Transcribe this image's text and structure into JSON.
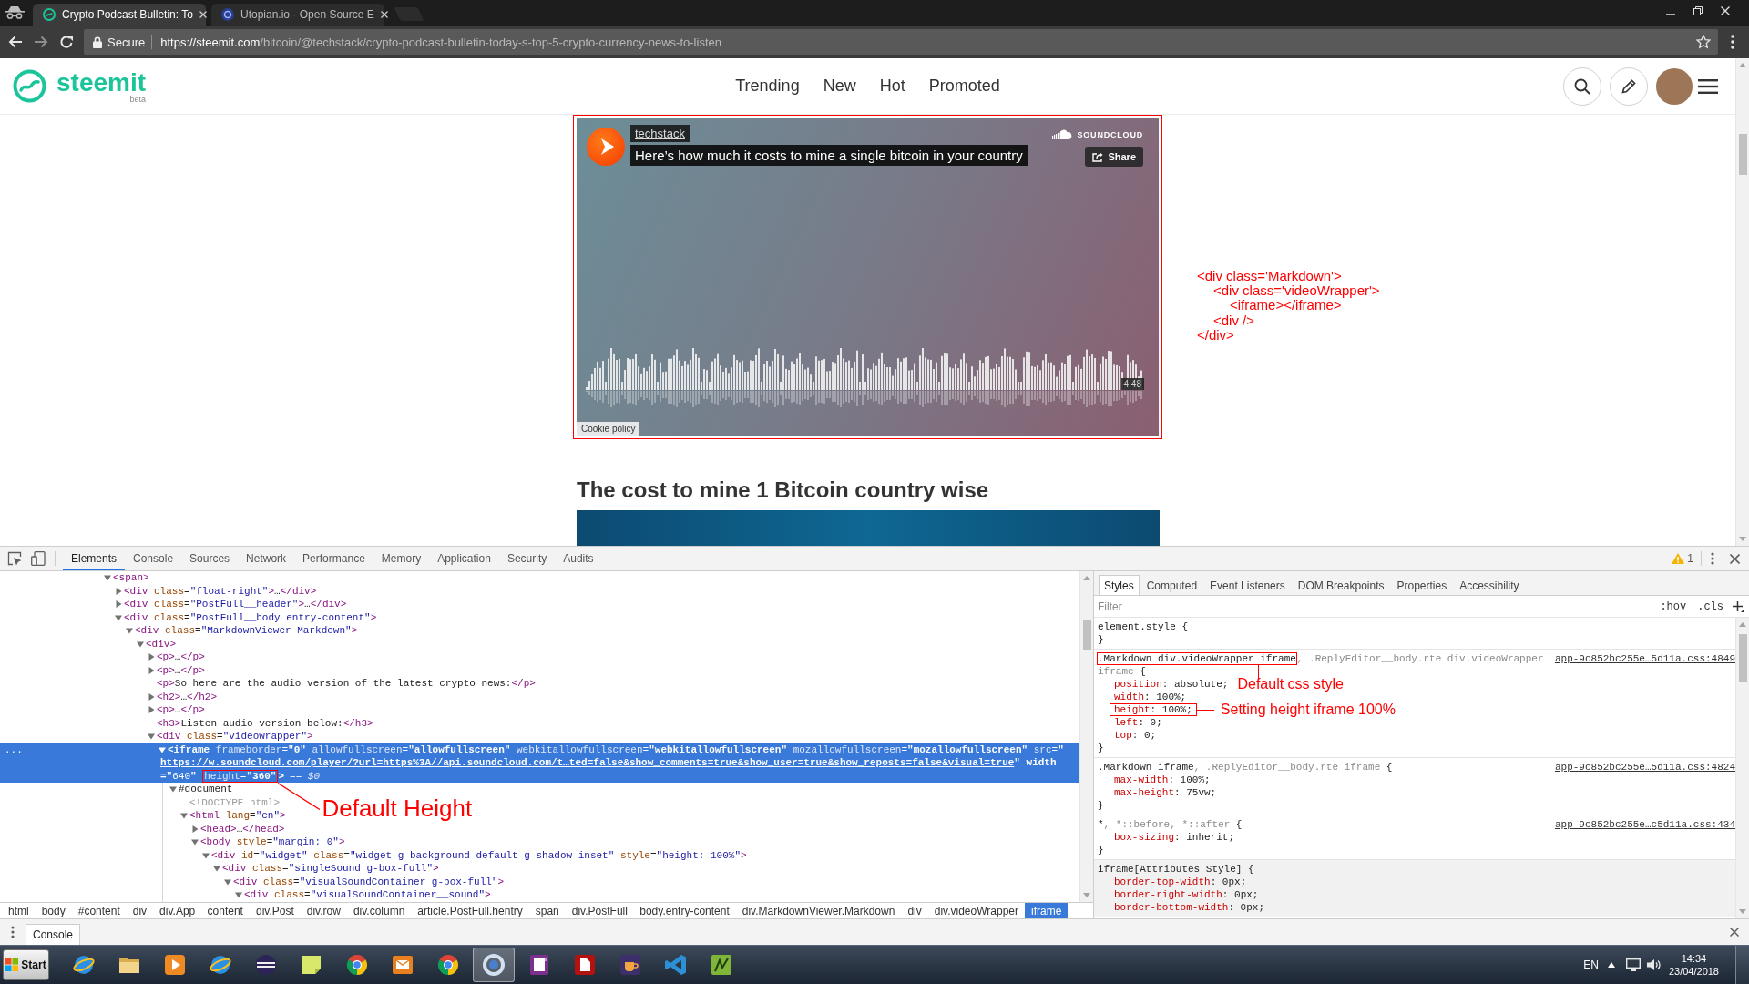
{
  "browser": {
    "tabs": [
      {
        "title": "Crypto Podcast Bulletin: To",
        "favicon": {
          "kind": "swirl"
        },
        "selected": true
      },
      {
        "title": "Utopian.io - Open Source E",
        "favicon": {
          "kind": "disc"
        },
        "selected": false
      }
    ],
    "secure_label": "Secure",
    "url": {
      "host": "https://steemit.com",
      "path": "/bitcoin/@techstack/crypto-podcast-bulletin-today-s-top-5-crypto-currency-news-to-listen"
    }
  },
  "site_header": {
    "logo_text": "steemit",
    "logo_badge": "beta",
    "nav": [
      "Trending",
      "New",
      "Hot",
      "Promoted"
    ]
  },
  "player": {
    "user": "techstack",
    "title": "Here’s how much it costs to mine a single bitcoin in your country",
    "brand": "SOUNDCLOUD",
    "share": "Share",
    "duration": "4:48",
    "cookie_policy": "Cookie policy"
  },
  "code_note": [
    {
      "text": "<div class='Markdown'>",
      "children": [
        {
          "text": "<div class='videoWrapper'>",
          "children": [
            {
              "text": "<iframe></iframe>"
            }
          ]
        },
        {
          "text": "<div />"
        }
      ]
    },
    {
      "text": "</div>"
    }
  ],
  "article": {
    "heading": "The cost to mine 1 Bitcoin country wise"
  },
  "devtools": {
    "tabs": [
      {
        "label": "Elements",
        "selected": true
      },
      {
        "label": "Console",
        "selected": false
      },
      {
        "label": "Sources",
        "selected": false
      },
      {
        "label": "Network",
        "selected": false
      },
      {
        "label": "Performance",
        "selected": false
      },
      {
        "label": "Memory",
        "selected": false
      },
      {
        "label": "Application",
        "selected": false
      },
      {
        "label": "Security",
        "selected": false
      },
      {
        "label": "Audits",
        "selected": false
      }
    ],
    "warning_count": "1",
    "dom_tree": [
      {
        "kind": "element",
        "markup": "<span>",
        "expanded": true,
        "selected": false,
        "children": [
          {
            "kind": "element",
            "markup": "<div class=\"float-right\">…</div>",
            "expanded": false,
            "selected": false
          },
          {
            "kind": "element",
            "markup": "<div class=\"PostFull__header\">…</div>",
            "expanded": false,
            "selected": false
          },
          {
            "kind": "element",
            "markup": "<div class=\"PostFull__body entry-content\">",
            "expanded": true,
            "selected": false,
            "children": [
              {
                "kind": "element",
                "markup": "<div class=\"MarkdownViewer Markdown\">",
                "expanded": true,
                "selected": false,
                "children": [
                  {
                    "kind": "element",
                    "markup": "<div>",
                    "expanded": true,
                    "selected": false,
                    "children": [
                      {
                        "kind": "element",
                        "markup": "<p>…</p>",
                        "expanded": false,
                        "selected": false
                      },
                      {
                        "kind": "element",
                        "markup": "<p>…</p>",
                        "expanded": false,
                        "selected": false
                      },
                      {
                        "kind": "leaf",
                        "markup": "<p>So here are the audio version of the latest crypto news:</p>",
                        "selected": false
                      },
                      {
                        "kind": "element",
                        "markup": "<h2>…</h2>",
                        "expanded": false,
                        "selected": false
                      },
                      {
                        "kind": "element",
                        "markup": "<p>…</p>",
                        "expanded": false,
                        "selected": false
                      },
                      {
                        "kind": "leaf",
                        "markup": "<h3>Listen audio version below:</h3>",
                        "selected": false
                      },
                      {
                        "kind": "element",
                        "markup": "<div class=\"videoWrapper\">",
                        "expanded": true,
                        "selected": false,
                        "children": [
                          {
                            "kind": "element",
                            "gutter": "...",
                            "markup_parts": [
                              {
                                "kind": "markup",
                                "text": "<iframe frameborder=\"0\" allowfullscreen=\"allowfullscreen\" webkitallowfullscreen=\"webkitallowfullscreen\" mozallowfullscreen=\"mozallowfullscreen\" src=\""
                              },
                              {
                                "kind": "link",
                                "text": "https://w.soundcloud.com/player/?url=https%3A//api.soundcloud.com/t…ted=false&show_comments=true&show_user=true&show_reposts=false&visual=true"
                              },
                              {
                                "kind": "markup",
                                "text": "\" width=\"640\" "
                              },
                              {
                                "kind": "boxed",
                                "text": "height=\"360\"",
                                "note": {
                                  "kind": "diagonal",
                                  "text": "Default Height"
                                }
                              },
                              {
                                "kind": "markup",
                                "text": ">"
                              }
                            ],
                            "suffix": "== $0",
                            "expanded": true,
                            "selected": true,
                            "children": [
                              {
                                "kind": "document",
                                "markup": "#document",
                                "expanded": true,
                                "selected": false,
                                "children": [
                                  {
                                    "kind": "doctype",
                                    "markup": "<!DOCTYPE html>",
                                    "selected": false
                                  },
                                  {
                                    "kind": "element",
                                    "markup": "<html lang=\"en\">",
                                    "expanded": true,
                                    "selected": false,
                                    "children": [
                                      {
                                        "kind": "element",
                                        "markup": "<head>…</head>",
                                        "expanded": false,
                                        "selected": false
                                      },
                                      {
                                        "kind": "element",
                                        "markup": "<body style=\"margin: 0\">",
                                        "expanded": true,
                                        "selected": false,
                                        "children": [
                                          {
                                            "kind": "element",
                                            "markup": "<div id=\"widget\" class=\"widget g-background-default g-shadow-inset\" style=\"height: 100%\">",
                                            "expanded": true,
                                            "selected": false,
                                            "children": [
                                              {
                                                "kind": "element",
                                                "markup": "<div class=\"singleSound g-box-full\">",
                                                "expanded": true,
                                                "selected": false,
                                                "children": [
                                                  {
                                                    "kind": "element",
                                                    "markup": "<div class=\"visualSoundContainer g-box-full\">",
                                                    "expanded": true,
                                                    "selected": false,
                                                    "children": [
                                                      {
                                                        "kind": "element",
                                                        "markup": "<div class=\"visualSoundContainer__sound\">",
                                                        "expanded": true,
                                                        "selected": false
                                                      }
                                                    ]
                                                  }
                                                ]
                                              }
                                            ]
                                          }
                                        ]
                                      }
                                    ]
                                  }
                                ]
                              }
                            ]
                          }
                        ]
                      }
                    ]
                  }
                ]
              }
            ]
          }
        ]
      }
    ],
    "breadcrumbs": [
      {
        "label": "html",
        "selected": false
      },
      {
        "label": "body",
        "selected": false
      },
      {
        "label": "#content",
        "selected": false
      },
      {
        "label": "div",
        "selected": false
      },
      {
        "label": "div.App__content",
        "selected": false
      },
      {
        "label": "div.Post",
        "selected": false
      },
      {
        "label": "div.row",
        "selected": false
      },
      {
        "label": "div.column",
        "selected": false
      },
      {
        "label": "article.PostFull.hentry",
        "selected": false
      },
      {
        "label": "span",
        "selected": false
      },
      {
        "label": "div.PostFull__body.entry-content",
        "selected": false
      },
      {
        "label": "div.MarkdownViewer.Markdown",
        "selected": false
      },
      {
        "label": "div",
        "selected": false
      },
      {
        "label": "div.videoWrapper",
        "selected": false
      },
      {
        "label": "iframe",
        "selected": true
      }
    ],
    "styles_tabs": [
      {
        "label": "Styles",
        "selected": true
      },
      {
        "label": "Computed",
        "selected": false
      },
      {
        "label": "Event Listeners",
        "selected": false
      },
      {
        "label": "DOM Breakpoints",
        "selected": false
      },
      {
        "label": "Properties",
        "selected": false
      },
      {
        "label": "Accessibility",
        "selected": false
      }
    ],
    "filter_placeholder": "Filter",
    "style_toggles": [
      ":hov",
      ".cls"
    ],
    "rules": [
      {
        "readonly": false,
        "selectors": [
          {
            "text": "element.style",
            "matched": true,
            "boxed": false
          }
        ],
        "open": "{",
        "close": "}"
      },
      {
        "readonly": false,
        "selectors": [
          {
            "text": ".Markdown div.videoWrapper iframe",
            "matched": true,
            "boxed": true
          },
          {
            "text": ", .ReplyEditor__body.rte div.videoWrapper ",
            "matched": false,
            "boxed": false
          },
          {
            "text": "iframe",
            "matched": false,
            "boxed": false
          }
        ],
        "open": "{",
        "source": "app-9c852bc255e…5d11a.css:4849",
        "declarations": [
          {
            "text": "position: absolute;",
            "boxed": false,
            "note": {
              "kind": "from_above",
              "text": "Default css style"
            }
          },
          {
            "text": "width: 100%;",
            "boxed": false
          },
          {
            "text": "height: 100%;",
            "boxed": true,
            "note": {
              "kind": "from_left",
              "text": "Setting height iframe 100%"
            }
          },
          {
            "text": "left: 0;",
            "boxed": false
          },
          {
            "text": "top: 0;",
            "boxed": false
          }
        ],
        "close": "}"
      },
      {
        "readonly": false,
        "selectors": [
          {
            "text": ".Markdown iframe",
            "matched": true,
            "boxed": false
          },
          {
            "text": ", .ReplyEditor__body.rte iframe",
            "matched": false,
            "boxed": false
          }
        ],
        "open": "{",
        "source": "app-9c852bc255e…5d11a.css:4824",
        "declarations": [
          {
            "text": "max-width: 100%;",
            "boxed": false
          },
          {
            "text": "max-height: 75vw;",
            "boxed": false
          }
        ],
        "close": "}"
      },
      {
        "readonly": false,
        "selectors": [
          {
            "text": "*",
            "matched": true,
            "boxed": false
          },
          {
            "text": ", *::before, *::after",
            "matched": false,
            "boxed": false
          }
        ],
        "open": "{",
        "source": "app-9c852bc255e…c5d11a.css:434",
        "declarations": [
          {
            "text": "box-sizing: inherit;",
            "boxed": false
          }
        ],
        "close": "}"
      },
      {
        "readonly": true,
        "selectors": [
          {
            "text": "iframe[Attributes Style]",
            "matched": true,
            "boxed": false
          }
        ],
        "open": "{",
        "declarations": [
          {
            "text": "border-top-width: 0px;",
            "boxed": false
          },
          {
            "text": "border-right-width: 0px;",
            "boxed": false
          },
          {
            "text": "border-bottom-width: 0px;",
            "boxed": false
          }
        ]
      }
    ],
    "drawer_tabs": [
      {
        "label": "Console",
        "selected": true
      }
    ]
  },
  "taskbar": {
    "start_label": "Start",
    "apps": [
      {
        "kind": "globe",
        "selected": false
      },
      {
        "kind": "folder",
        "selected": false
      },
      {
        "kind": "media",
        "selected": false
      },
      {
        "kind": "globe",
        "selected": false
      },
      {
        "kind": "sphere",
        "selected": false
      },
      {
        "kind": "note",
        "selected": false
      },
      {
        "kind": "wheel",
        "selected": false
      },
      {
        "kind": "mail",
        "selected": false
      },
      {
        "kind": "wheel",
        "selected": false
      },
      {
        "kind": "ring",
        "selected": true
      },
      {
        "kind": "notebook",
        "selected": false
      },
      {
        "kind": "pdf",
        "selected": false
      },
      {
        "kind": "cup",
        "selected": false
      },
      {
        "kind": "ribbon",
        "selected": false
      },
      {
        "kind": "chart",
        "selected": false
      }
    ],
    "language": "EN",
    "time": "14:34",
    "date": "23/04/2018"
  }
}
